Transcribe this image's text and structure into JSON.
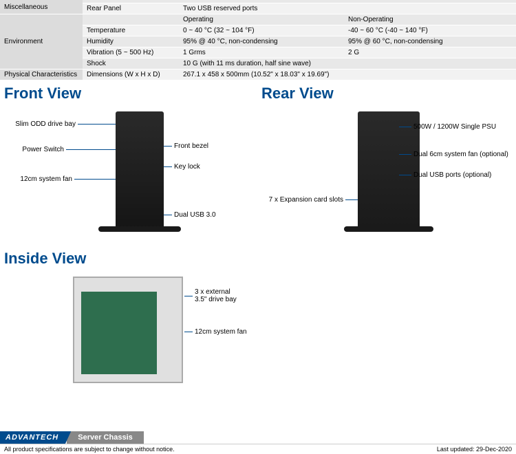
{
  "spec": {
    "misc": {
      "cat": "Miscellaneous",
      "row2_label": "Rear Panel",
      "row2_val": "Two USB reserved ports"
    },
    "env": {
      "cat": "Environment",
      "header_op": "Operating",
      "header_nop": "Non-Operating",
      "temp_label": "Temperature",
      "temp_op": "0 ~ 40 °C (32 ~ 104 °F)",
      "temp_nop": "-40 ~ 60 °C (-40 ~ 140 °F)",
      "hum_label": "Humidity",
      "hum_op": "95% @ 40 °C, non-condensing",
      "hum_nop": "95% @ 60 °C, non-condensing",
      "vib_label": "Vibration (5 ~ 500 Hz)",
      "vib_op": "1 Grms",
      "vib_nop": "2 G",
      "shock_label": "Shock",
      "shock_val": "10 G (with 11 ms duration, half sine wave)"
    },
    "phys": {
      "cat": "Physical Characteristics",
      "dim_label": "Dimensions (W x H x D)",
      "dim_val": "267.1 x 458 x 500mm (10.52\" x 18.03\" x 19.69\")"
    }
  },
  "views": {
    "front_title": "Front View",
    "rear_title": "Rear View",
    "inside_title": "Inside View"
  },
  "callouts": {
    "front": {
      "odd": "Slim ODD drive bay",
      "power": "Power Switch",
      "fan12": "12cm system fan",
      "bezel": "Front bezel",
      "keylock": "Key lock",
      "usb": "Dual USB 3.0"
    },
    "rear": {
      "psu": "500W / 1200W Single PSU",
      "fan6": "Dual 6cm system fan (optional)",
      "usb": "Dual USB ports (optional)",
      "slots": "7 x Expansion card slots"
    },
    "inside": {
      "bays": "3 x external\n3.5\" drive bay",
      "fan12": "12cm system fan"
    }
  },
  "footer": {
    "brand": "ADVANTECH",
    "category": "Server Chassis",
    "disclaimer": "All product specifications are subject to change without notice.",
    "updated": "Last updated: 29-Dec-2020"
  }
}
